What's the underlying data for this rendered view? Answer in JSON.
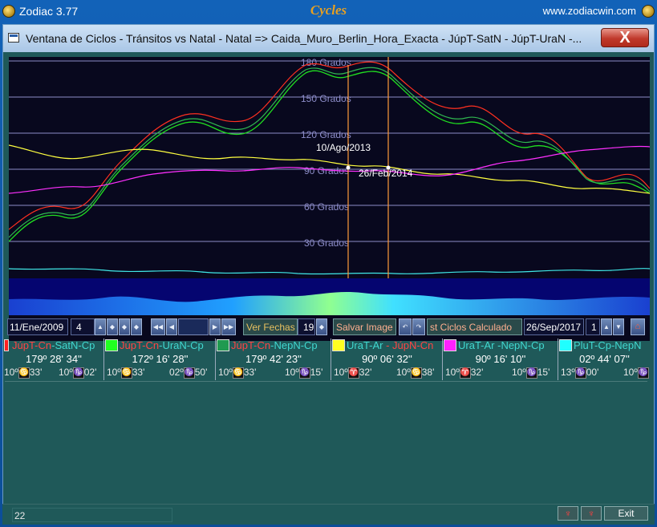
{
  "app": {
    "title": "Zodiac 3.77",
    "center_title": "Cycles",
    "url": "www.zodiacwin.com"
  },
  "window": {
    "title": "Ventana de Ciclos - Tránsitos vs Natal - Natal => Caida_Muro_Berlin_Hora_Exacta - JúpT-SatN - JúpT-UraN -...",
    "close_label": "X"
  },
  "chart": {
    "grid_labels": [
      "180 Grados",
      "150 Grados",
      "120 Grados",
      "90 Grados",
      "60 Grados",
      "30 Grados"
    ],
    "markers": [
      {
        "date": "10/Ago/2013"
      },
      {
        "date": "26/Feb/2014"
      }
    ],
    "colors": {
      "background": "#08081e",
      "grid": "#8c8cc8",
      "marker": "#ff9a3a",
      "series_red": "#ff2020",
      "series_green": "#20ff20",
      "series_darkgreen": "#20a050",
      "series_yellow": "#ffff40",
      "series_magenta": "#ff30ff",
      "series_cyan": "#40ffff"
    }
  },
  "toolbar": {
    "start_date": "11/Ene/2009",
    "step_value": "4",
    "view_dates_label": "Ver Fechas",
    "view_dates_value": "19",
    "save_image_label": "Salvar Image",
    "list_cycles_label": "st Ciclos Calculado",
    "end_date": "26/Sep/2017",
    "zoom_value": "1"
  },
  "pairs": [
    {
      "first": "JúpT-Cn",
      "second": "-SatN-Cp",
      "color": "#ff2020",
      "value": "179º 28' 34''",
      "pos_left": "10º",
      "sign_left": "♋",
      "min_left": "33'",
      "pos_right": "10º",
      "sign_right": "♑",
      "min_right": "02'"
    },
    {
      "first": "JúpT-Cn",
      "second": "-UraN-Cp",
      "color": "#20ff20",
      "value": "172º 16' 28''",
      "pos_left": "10º",
      "sign_left": "♋",
      "min_left": "33'",
      "pos_right": "02º",
      "sign_right": "♑",
      "min_right": "50'"
    },
    {
      "first": "JúpT-Cn",
      "second": "-NepN-Cp",
      "color": "#209a50",
      "value": "179º 42' 23''",
      "pos_left": "10º",
      "sign_left": "♋",
      "min_left": "33'",
      "pos_right": "10º",
      "sign_right": "♑",
      "min_right": "15'"
    },
    {
      "first": "UraT-Ar",
      "second": " - JúpN-Cn",
      "color": "#ffff20",
      "value": "90º 06' 32''",
      "pos_left": "10º",
      "sign_left": "♈",
      "min_left": "32'",
      "pos_right": "10º",
      "sign_right": "♋",
      "min_right": "38'"
    },
    {
      "first": "UraT-Ar",
      "second": " -NepN-Cp",
      "color": "#ff20ff",
      "value": "90º 16' 10''",
      "pos_left": "10º",
      "sign_left": "♈",
      "min_left": "32'",
      "pos_right": "10º",
      "sign_right": "♑",
      "min_right": "15'"
    },
    {
      "first": "PluT-Cp",
      "second": "-NepN",
      "color": "#20ffff",
      "value": "02º 44' 07''",
      "pos_left": "13º",
      "sign_left": "♑",
      "min_left": "00'",
      "pos_right": "10º",
      "sign_right": "♑",
      "min_right": ""
    }
  ],
  "status": {
    "text": "22",
    "exit_label": "Exit"
  }
}
